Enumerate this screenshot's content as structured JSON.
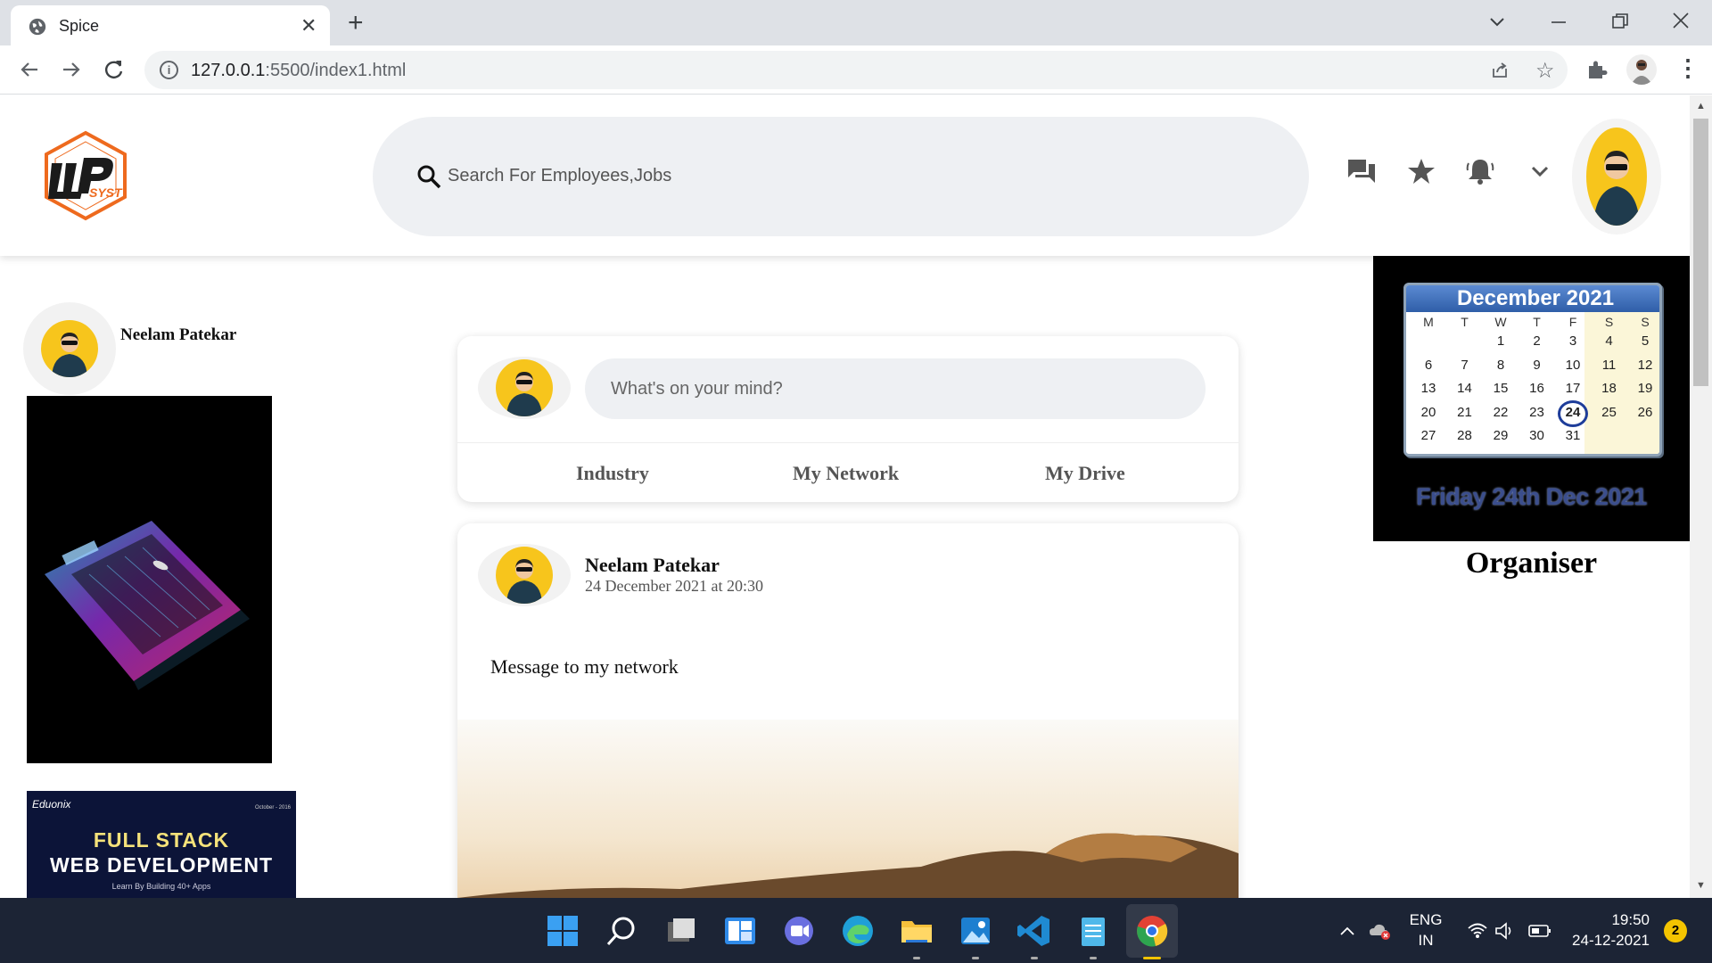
{
  "browser": {
    "tab_title": "Spice",
    "url_host": "127.0.0.1",
    "url_rest": ":5500/index1.html"
  },
  "header": {
    "search_placeholder": "Search For Employees,Jobs"
  },
  "left": {
    "user_name": "Neelam Patekar",
    "ad_course": {
      "brand": "Eduonix",
      "date": "October - 2016",
      "line1": "FULL STACK",
      "line2": "WEB DEVELOPMENT",
      "line3": "Learn By Building 40+ Apps"
    }
  },
  "composer": {
    "placeholder": "What's on your mind?",
    "options": [
      "Industry",
      "My Network",
      "My Drive"
    ]
  },
  "post": {
    "author": "Neelam Patekar",
    "timestamp": "24 December 2021 at 20:30",
    "message": "Message to my network"
  },
  "calendar": {
    "month_title": "December 2021",
    "weekdays": [
      "M",
      "T",
      "W",
      "T",
      "F",
      "S",
      "S"
    ],
    "weeks": [
      [
        "",
        "",
        "1",
        "2",
        "3",
        "4",
        "5"
      ],
      [
        "6",
        "7",
        "8",
        "9",
        "10",
        "11",
        "12"
      ],
      [
        "13",
        "14",
        "15",
        "16",
        "17",
        "18",
        "19"
      ],
      [
        "20",
        "21",
        "22",
        "23",
        "24",
        "25",
        "26"
      ],
      [
        "27",
        "28",
        "29",
        "30",
        "31",
        "",
        ""
      ]
    ],
    "today": "24",
    "caption": "Friday 24th Dec 2021",
    "widget_title": "Organiser"
  },
  "taskbar": {
    "lang_1": "ENG",
    "lang_2": "IN",
    "time": "19:50",
    "date": "24-12-2021",
    "notifications": "2"
  },
  "colors": {
    "avatar_bg": "#f7c51c",
    "taskbar_bg": "#1c2435",
    "tabstrip_bg": "#dee1e6"
  }
}
